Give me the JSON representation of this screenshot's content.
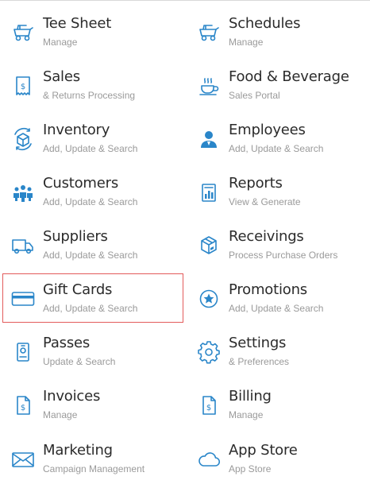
{
  "colors": {
    "accent": "#2a86c9",
    "title_text": "#2b2b2b",
    "subtitle_text": "#9a9a9a",
    "selection_border": "#e35b5b"
  },
  "menu": {
    "items": [
      {
        "title": "Tee Sheet",
        "subtitle": "Manage",
        "icon": "golf-cart-icon"
      },
      {
        "title": "Schedules",
        "subtitle": "Manage",
        "icon": "golf-cart-icon"
      },
      {
        "title": "Sales",
        "subtitle": "& Returns Processing",
        "icon": "receipt-dollar-icon"
      },
      {
        "title": "Food & Beverage",
        "subtitle": "Sales Portal",
        "icon": "coffee-cup-icon"
      },
      {
        "title": "Inventory",
        "subtitle": "Add, Update & Search",
        "icon": "inventory-box-cycle-icon"
      },
      {
        "title": "Employees",
        "subtitle": "Add, Update & Search",
        "icon": "employee-person-icon"
      },
      {
        "title": "Customers",
        "subtitle": "Add, Update & Search",
        "icon": "customers-group-icon"
      },
      {
        "title": "Reports",
        "subtitle": "View & Generate",
        "icon": "report-chart-icon"
      },
      {
        "title": "Suppliers",
        "subtitle": "Add, Update & Search",
        "icon": "delivery-truck-icon"
      },
      {
        "title": "Receivings",
        "subtitle": "Process Purchase Orders",
        "icon": "package-box-icon"
      },
      {
        "title": "Gift Cards",
        "subtitle": "Add, Update & Search",
        "icon": "gift-card-icon"
      },
      {
        "title": "Promotions",
        "subtitle": "Add, Update & Search",
        "icon": "star-badge-icon"
      },
      {
        "title": "Passes",
        "subtitle": "Update & Search",
        "icon": "pass-badge-icon"
      },
      {
        "title": "Settings",
        "subtitle": "& Preferences",
        "icon": "gear-icon"
      },
      {
        "title": "Invoices",
        "subtitle": "Manage",
        "icon": "invoice-dollar-icon"
      },
      {
        "title": "Billing",
        "subtitle": "Manage",
        "icon": "billing-dollar-icon"
      },
      {
        "title": "Marketing",
        "subtitle": "Campaign Management",
        "icon": "envelope-icon"
      },
      {
        "title": "App Store",
        "subtitle": "App Store",
        "icon": "cloud-icon"
      }
    ]
  }
}
